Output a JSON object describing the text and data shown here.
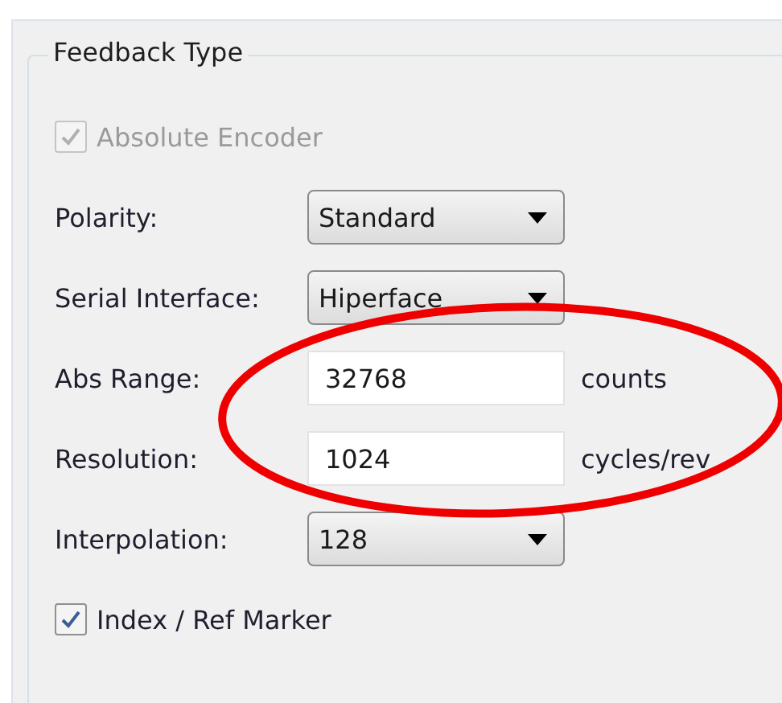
{
  "group": {
    "title": "Feedback Type"
  },
  "rows": [
    {
      "kind": "checkbox",
      "label": "Absolute Encoder",
      "checked": true,
      "disabled": true
    },
    {
      "kind": "dropdown",
      "label": "Polarity:",
      "value": "Standard"
    },
    {
      "kind": "dropdown",
      "label": "Serial Interface:",
      "value": "Hiperface"
    },
    {
      "kind": "input",
      "label": "Abs Range:",
      "value": "32768",
      "unit": "counts"
    },
    {
      "kind": "input",
      "label": "Resolution:",
      "value": "1024",
      "unit": "cycles/rev"
    },
    {
      "kind": "dropdown",
      "label": "Interpolation:",
      "value": "128"
    },
    {
      "kind": "checkbox",
      "label": "Index / Ref Marker",
      "checked": true,
      "disabled": false
    }
  ],
  "annotation": {
    "kind": "ellipse",
    "color": "#ee0000"
  }
}
